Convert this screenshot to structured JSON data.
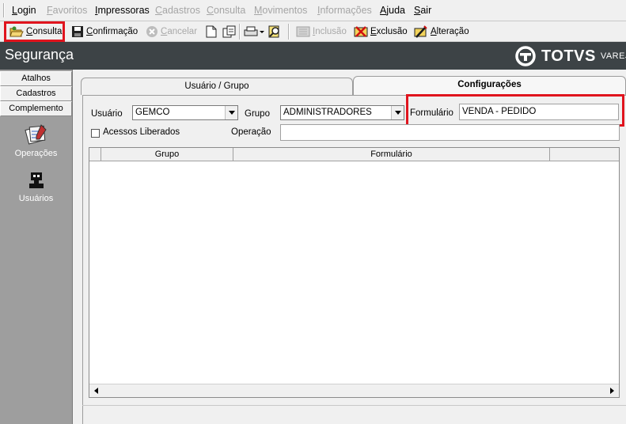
{
  "menu": [
    {
      "label": "Login",
      "enabled": true
    },
    {
      "label": "Favoritos",
      "enabled": false
    },
    {
      "label": "Impressoras",
      "enabled": true
    },
    {
      "label": "Cadastros",
      "enabled": false
    },
    {
      "label": "Consulta",
      "enabled": false
    },
    {
      "label": "Movimentos",
      "enabled": false
    },
    {
      "label": "Informações",
      "enabled": false
    },
    {
      "label": "Ajuda",
      "enabled": true
    },
    {
      "label": "Sair",
      "enabled": true
    }
  ],
  "toolbar": {
    "consulta": "Consulta",
    "confirmacao": "Confirmação",
    "cancelar": "Cancelar",
    "inclusao": "Inclusão",
    "exclusao": "Exclusão",
    "alteracao": "Alteração"
  },
  "header": {
    "title": "Segurança",
    "brand": "TOTVS",
    "brand_sub": "VAREJO"
  },
  "sidebar": {
    "buttons": [
      "Atalhos",
      "Cadastros",
      "Complemento"
    ],
    "items": [
      {
        "label": "Operações",
        "icon": "operations-icon"
      },
      {
        "label": "Usuários",
        "icon": "users-icon"
      }
    ]
  },
  "tabs": [
    {
      "label": "Usuário  / Grupo",
      "active": false
    },
    {
      "label": "Configurações",
      "active": true
    }
  ],
  "form": {
    "usuario_label": "Usuário",
    "usuario_value": "GEMCO",
    "grupo_label": "Grupo",
    "grupo_value": "ADMINISTRADORES",
    "formulario_label": "Formulário",
    "formulario_value": "VENDA - PEDIDO",
    "acessos_label": "Acessos Liberados",
    "operacao_label": "Operação",
    "operacao_value": ""
  },
  "grid": {
    "columns": [
      "Grupo",
      "Formulário",
      ""
    ],
    "rows": []
  },
  "colors": {
    "highlight": "#e0141e",
    "header_bg": "#3d4346",
    "sidebar_bg": "#9e9e9e"
  }
}
